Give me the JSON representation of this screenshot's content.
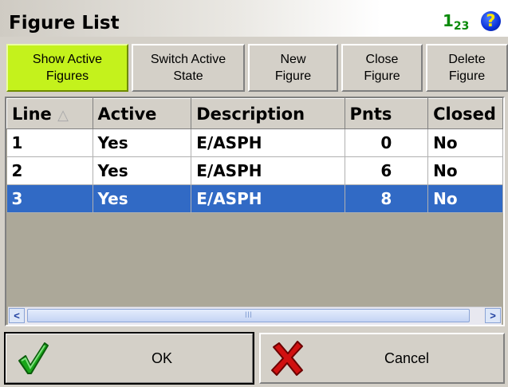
{
  "window": {
    "title": "Figure List",
    "number_icon_main": "1",
    "number_icon_sub": "2",
    "number_icon_sub2": "3",
    "help_icon": "?"
  },
  "toolbar": {
    "buttons": [
      {
        "label": "Show Active\nFigures",
        "active": true
      },
      {
        "label": "Switch Active\nState",
        "active": false
      },
      {
        "label": "New\nFigure",
        "active": false
      },
      {
        "label": "Close\nFigure",
        "active": false
      },
      {
        "label": "Delete\nFigure",
        "active": false
      }
    ]
  },
  "table": {
    "columns": [
      "Line",
      "Active",
      "Description",
      "Pnts",
      "Closed"
    ],
    "sort_indicator": "△",
    "rows": [
      {
        "line": "1",
        "active": "Yes",
        "description": "E/ASPH",
        "pnts": "0",
        "closed": "No"
      },
      {
        "line": "2",
        "active": "Yes",
        "description": "E/ASPH",
        "pnts": "6",
        "closed": "No"
      },
      {
        "line": "3",
        "active": "Yes",
        "description": "E/ASPH",
        "pnts": "8",
        "closed": "No"
      }
    ],
    "selected_row": 3
  },
  "scrollbar": {
    "thumb_grip": "III",
    "left_arrow": "<",
    "right_arrow": ">"
  },
  "buttons": {
    "ok_label": "OK",
    "cancel_label": "Cancel"
  },
  "colors": {
    "active_button": "#c4f21c",
    "selection": "#316ac5",
    "check": "#1aa61a",
    "cross": "#d01010"
  }
}
